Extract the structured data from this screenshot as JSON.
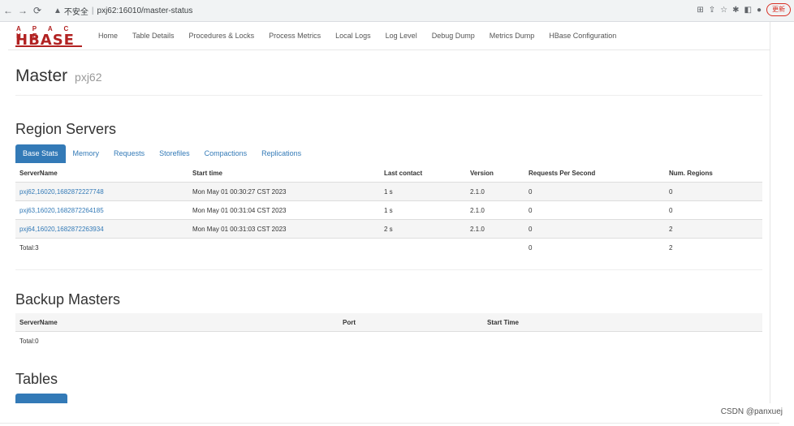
{
  "browser": {
    "url_warning": "不安全",
    "url": "pxj62:16010/master-status",
    "update_label": "更新"
  },
  "logo": {
    "top": "A P A C H E",
    "main": "HBASE"
  },
  "nav": [
    "Home",
    "Table Details",
    "Procedures & Locks",
    "Process Metrics",
    "Local Logs",
    "Log Level",
    "Debug Dump",
    "Metrics Dump",
    "HBase Configuration"
  ],
  "page": {
    "title": "Master",
    "host": "pxj62"
  },
  "region_servers": {
    "heading": "Region Servers",
    "tabs": [
      "Base Stats",
      "Memory",
      "Requests",
      "Storefiles",
      "Compactions",
      "Replications"
    ],
    "columns": [
      "ServerName",
      "Start time",
      "Last contact",
      "Version",
      "Requests Per Second",
      "Num. Regions"
    ],
    "rows": [
      [
        "pxj62,16020,1682872227748",
        "Mon May 01 00:30:27 CST 2023",
        "1 s",
        "2.1.0",
        "0",
        "0"
      ],
      [
        "pxj63,16020,1682872264185",
        "Mon May 01 00:31:04 CST 2023",
        "1 s",
        "2.1.0",
        "0",
        "0"
      ],
      [
        "pxj64,16020,1682872263934",
        "Mon May 01 00:31:03 CST 2023",
        "2 s",
        "2.1.0",
        "0",
        "2"
      ]
    ],
    "total": {
      "label": "Total:3",
      "requests": "0",
      "regions": "2"
    }
  },
  "backup_masters": {
    "heading": "Backup Masters",
    "columns": [
      "ServerName",
      "Port",
      "Start Time"
    ],
    "total": "Total:0"
  },
  "tables": {
    "heading": "Tables"
  },
  "watermark": "CSDN @panxuej"
}
